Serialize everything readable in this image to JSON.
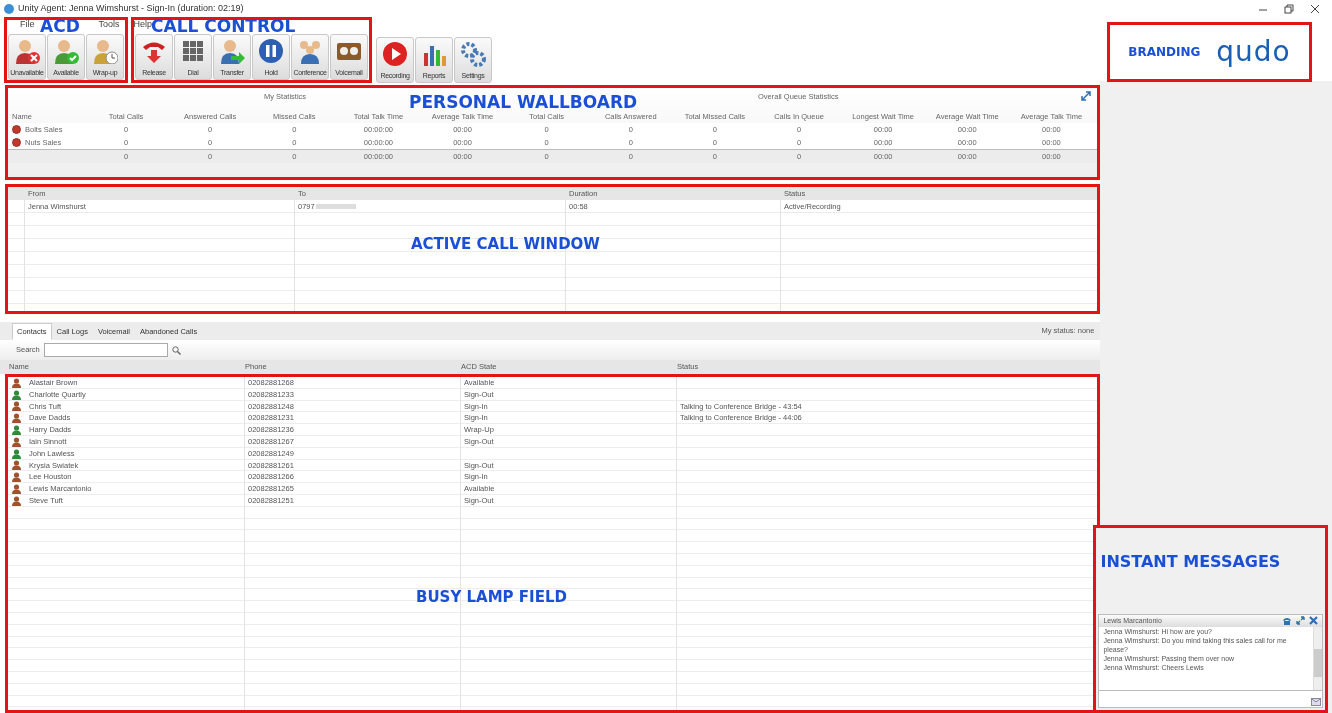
{
  "window": {
    "title": "Unity Agent: Jenna Wimshurst - Sign-In (duration: 02:19)"
  },
  "menu": [
    "File",
    "Tools",
    "Help"
  ],
  "toolbar": {
    "groups": [
      {
        "annotation": "ACD",
        "buttons": [
          {
            "kind": "unavailable",
            "label": "Unavailable"
          },
          {
            "kind": "available",
            "label": "Available"
          },
          {
            "kind": "wrapup",
            "label": "Wrap-up"
          }
        ]
      },
      {
        "annotation": "CALL CONTROL",
        "buttons": [
          {
            "kind": "release",
            "label": "Release"
          },
          {
            "kind": "dial",
            "label": "Dial"
          },
          {
            "kind": "transfer",
            "label": "Transfer"
          },
          {
            "kind": "hold",
            "label": "Hold"
          },
          {
            "kind": "conference",
            "label": "Conference"
          },
          {
            "kind": "voicemail",
            "label": "Voicemail"
          }
        ]
      },
      {
        "buttons": [
          {
            "kind": "recording",
            "label": "Recording"
          },
          {
            "kind": "reports",
            "label": "Reports"
          },
          {
            "kind": "settings",
            "label": "Settings"
          }
        ]
      }
    ]
  },
  "branding": {
    "annotation": "BRANDING",
    "logo": "qudo"
  },
  "wallboard": {
    "annotation": "PERSONAL WALLBOARD",
    "groups": [
      "My Statistics",
      "Overall Queue Statistics"
    ],
    "columns": [
      "Name",
      "Total Calls",
      "Answered Calls",
      "Missed Calls",
      "Total Talk Time",
      "Average Talk Time",
      "Total Calls",
      "Calls Answered",
      "Total Missed Calls",
      "Calls In Queue",
      "Longest Wait Time",
      "Average Wait Time",
      "Average Talk Time"
    ],
    "rows": [
      {
        "name": "Bolts Sales",
        "values": [
          "0",
          "0",
          "0",
          "00:00:00",
          "00:00",
          "0",
          "0",
          "0",
          "0",
          "00:00",
          "00:00",
          "00:00"
        ]
      },
      {
        "name": "Nuts Sales",
        "values": [
          "0",
          "0",
          "0",
          "00:00:00",
          "00:00",
          "0",
          "0",
          "0",
          "0",
          "00:00",
          "00:00",
          "00:00"
        ]
      }
    ],
    "totals": [
      "0",
      "0",
      "0",
      "00:00:00",
      "00:00",
      "0",
      "0",
      "0",
      "0",
      "00:00",
      "00:00",
      "00:00"
    ]
  },
  "active_calls": {
    "annotation": "ACTIVE CALL WINDOW",
    "columns": [
      "From",
      "To",
      "Duration",
      "Status"
    ],
    "rows": [
      {
        "from": "Jenna Wimshurst",
        "to": "0797",
        "duration": "00:58",
        "status": "Active/Recording"
      }
    ]
  },
  "tabs": [
    {
      "label": "Contacts",
      "selected": true
    },
    {
      "label": "Call Logs",
      "selected": false
    },
    {
      "label": "Voicemail",
      "selected": false
    },
    {
      "label": "Abandoned Calls",
      "selected": false
    }
  ],
  "my_status": "My status: none",
  "search": {
    "label": "Search"
  },
  "contacts": {
    "annotation": "BUSY LAMP FIELD",
    "columns": [
      "Name",
      "Phone",
      "ACD State",
      "Status"
    ],
    "rows": [
      {
        "name": "Alastair Brown",
        "phone": "02082881268",
        "acd_state": "Available",
        "color": "#a0522d"
      },
      {
        "name": "Charlotte Quartly",
        "phone": "02082881233",
        "acd_state": "Sign-Out",
        "color": "#2e8b3a"
      },
      {
        "name": "Chris Tuft",
        "phone": "02082881248",
        "acd_state": "Sign-In",
        "status": "Talking to Conference Bridge - 43:54",
        "color": "#a0522d"
      },
      {
        "name": "Dave Dadds",
        "phone": "02082881231",
        "acd_state": "Sign-In",
        "status": "Talking to Conference Bridge - 44:06",
        "color": "#a0522d"
      },
      {
        "name": "Harry Dadds",
        "phone": "02082881236",
        "acd_state": "Wrap-Up",
        "color": "#2e8b3a"
      },
      {
        "name": "Iain Sinnott",
        "phone": "02082881267",
        "acd_state": "Sign-Out",
        "color": "#a0522d"
      },
      {
        "name": "John Lawless",
        "phone": "02082881249",
        "color": "#2e8b3a"
      },
      {
        "name": "Krysia Swiatek",
        "phone": "02082881261",
        "acd_state": "Sign-Out",
        "color": "#a0522d"
      },
      {
        "name": "Lee Houston",
        "phone": "02082881266",
        "acd_state": "Sign-In",
        "color": "#a0522d"
      },
      {
        "name": "Lewis Marcantonio",
        "phone": "02082881265",
        "acd_state": "Available",
        "color": "#a0522d"
      },
      {
        "name": "Steve Tuft",
        "phone": "02082881251",
        "acd_state": "Sign-Out",
        "color": "#a0522d"
      }
    ]
  },
  "instant_messages": {
    "annotation": "INSTANT MESSAGES",
    "contact": "Lewis Marcantonio",
    "messages": [
      "Jenna Wimshurst: Hi how are you?",
      "Jenna Wimshurst: Do you mind taking this sales call for me please?",
      "Jenna Wimshurst: Passing them over now",
      "Jenna Wimshurst: Cheers Lewis"
    ]
  }
}
